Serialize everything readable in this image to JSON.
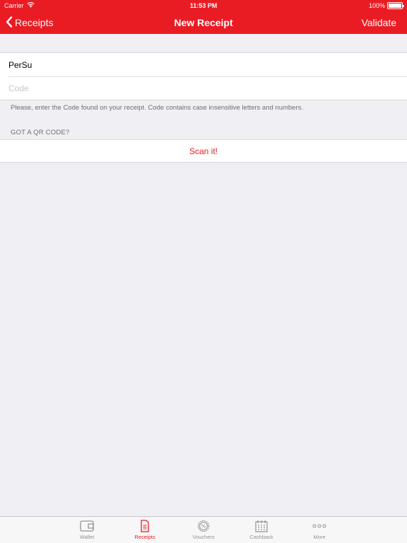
{
  "status_bar": {
    "carrier": "Carrier",
    "time": "11:53 PM",
    "battery": "100%",
    "battery_level": 1.0
  },
  "nav": {
    "back_label": "Receipts",
    "title": "New Receipt",
    "action_label": "Validate"
  },
  "form": {
    "name_value": "PerSu",
    "code_value": "",
    "code_placeholder": "Code"
  },
  "hint": "Please, enter the Code found on your receipt. Code contains case insensitive letters and numbers.",
  "qr": {
    "header": "GOT A QR CODE?",
    "scan_label": "Scan it!"
  },
  "tabs": [
    {
      "label": "Wallet",
      "icon": "wallet-icon",
      "active": false
    },
    {
      "label": "Receipts",
      "icon": "receipt-icon",
      "active": true
    },
    {
      "label": "Vouchers",
      "icon": "percent-badge-icon",
      "active": false
    },
    {
      "label": "Cashback",
      "icon": "calendar-icon",
      "active": false
    },
    {
      "label": "More",
      "icon": "more-dots-icon",
      "active": false
    }
  ],
  "colors": {
    "accent": "#e91c24",
    "background": "#efeff4",
    "tab_inactive": "#929292"
  }
}
